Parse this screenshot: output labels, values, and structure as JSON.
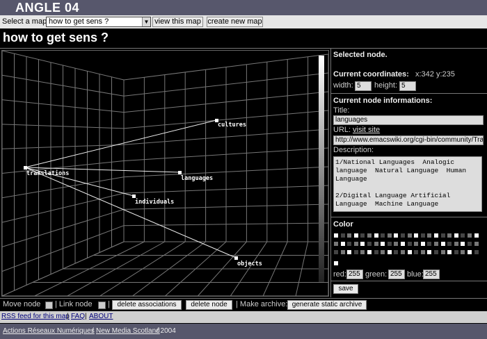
{
  "app": {
    "title": "ANGLE 04"
  },
  "mapbar": {
    "select_label": "Select a map :",
    "selected_map": "how to get sens ?",
    "view_button": "view this map",
    "create_button": "create new map"
  },
  "map": {
    "title": "how to get sens ?",
    "nodes": [
      {
        "label": "cultures"
      },
      {
        "label": "translations"
      },
      {
        "label": "languages"
      },
      {
        "label": "individuals"
      },
      {
        "label": "objects"
      }
    ]
  },
  "panel": {
    "selected_title": "Selected node.",
    "coords_title": "Current coordinates:",
    "coords_value": "x:342 y:235",
    "width_label": "width:",
    "width_value": "5",
    "height_label": "height:",
    "height_value": "5",
    "info_title": "Current node informations:",
    "title_label": "Title:",
    "title_value": "languages",
    "url_label": "URL:",
    "url_link": "visit site",
    "url_value": "http://www.emacswiki.org/cgi-bin/community/TransLanguages",
    "desc_label": "Description:",
    "desc_value": "1/National Languages  Analogic language  Natural Language  Human Language\n\n2/Digital Language Artificial Language  Machine Language",
    "color_title": "Color",
    "red_label": "red:",
    "red_value": "255",
    "green_label": "green:",
    "green_value": "255",
    "blue_label": "blue:",
    "blue_value": "255",
    "save_button": "save"
  },
  "toolbar": {
    "move_label": "Move node",
    "link_label": "| Link node",
    "sep": "|",
    "delete_assoc": "delete associations",
    "delete_node": "delete node",
    "archive_label": "| Make archive:",
    "generate_archive": "generate static archive"
  },
  "rss": {
    "rss_link": "RSS feed for this map",
    "faq": "FAQ",
    "about": "ABOUT",
    "sep": "|"
  },
  "footer": {
    "link1": "Actions Réseaux Numériques",
    "link2": "New Media Scotland",
    "year": "/ 2004"
  },
  "colors": {
    "header": "#57576c",
    "bar": "#e6e6e6",
    "swatch_white": "#ffffff",
    "swatch_grey": "#777777",
    "swatch_dark": "#444444"
  }
}
